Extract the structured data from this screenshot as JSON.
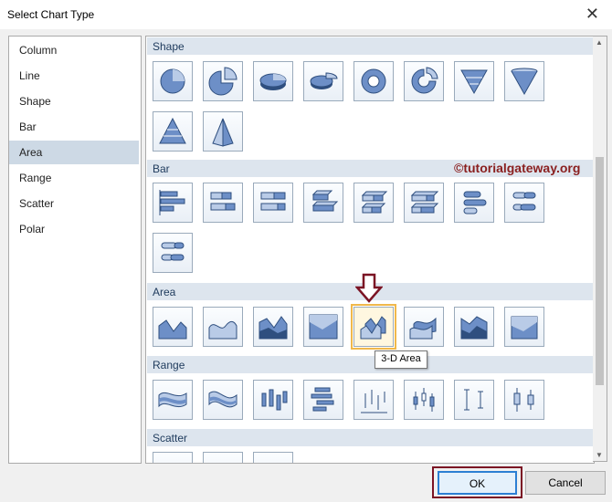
{
  "window": {
    "title": "Select Chart Type",
    "close_label": "✕"
  },
  "categories": [
    "Column",
    "Line",
    "Shape",
    "Bar",
    "Area",
    "Range",
    "Scatter",
    "Polar"
  ],
  "selected_category": "Area",
  "sections": {
    "shape": "Shape",
    "bar": "Bar",
    "area": "Area",
    "range": "Range",
    "scatter": "Scatter"
  },
  "tooltip": "3-D Area",
  "watermark": "©tutorialgateway.org",
  "buttons": {
    "ok": "OK",
    "cancel": "Cancel"
  },
  "colors": {
    "selection": "#cdd9e5",
    "highlight": "#f0b84b",
    "annotation": "#7b1424",
    "icon_fill": "#6d8fc7"
  }
}
